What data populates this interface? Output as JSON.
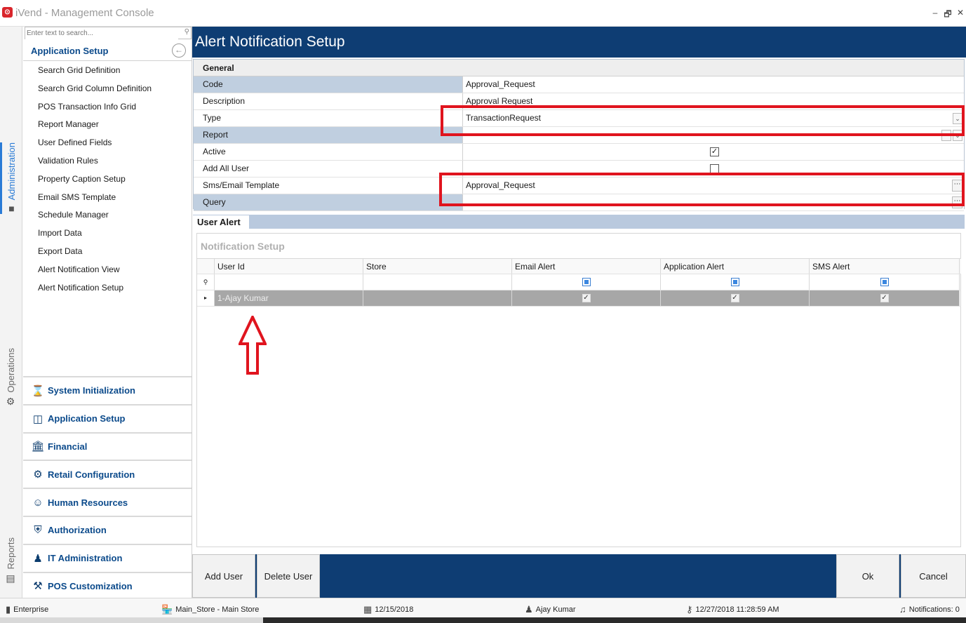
{
  "window": {
    "title": "iVend - Management Console",
    "icon_letter": "⊙",
    "minimize": "–",
    "restore": "🗗",
    "close": "✕"
  },
  "vertical_tabs": [
    {
      "label": "Administration",
      "icon": "administration-icon",
      "active": true
    },
    {
      "label": "Operations",
      "icon": "gear-icon",
      "active": false
    },
    {
      "label": "Reports",
      "icon": "reports-icon",
      "active": false
    }
  ],
  "search": {
    "placeholder": "Enter text to search..."
  },
  "nav": {
    "heading": "Application Setup",
    "items": [
      "Search Grid Definition",
      "Search Grid Column Definition",
      "POS Transaction Info Grid",
      "Report Manager",
      "User Defined Fields",
      "Validation Rules",
      "Property Caption Setup",
      "Email SMS Template",
      "Schedule Manager",
      "Import Data",
      "Export Data",
      "Alert Notification View",
      "Alert Notification Setup"
    ],
    "modules": [
      {
        "label": "System Initialization",
        "icon": "hourglass-icon"
      },
      {
        "label": "Application Setup",
        "icon": "window-icon"
      },
      {
        "label": "Financial",
        "icon": "bank-icon"
      },
      {
        "label": "Retail Configuration",
        "icon": "gears-icon"
      },
      {
        "label": "Human Resources",
        "icon": "users-icon"
      },
      {
        "label": "Authorization",
        "icon": "shield-icon"
      },
      {
        "label": "IT Administration",
        "icon": "user-icon"
      },
      {
        "label": "POS Customization",
        "icon": "pos-icon"
      }
    ]
  },
  "page": {
    "title": "Alert Notification Setup"
  },
  "form": {
    "section": "General",
    "rows": [
      {
        "label": "Code",
        "value": "Approval_Request"
      },
      {
        "label": "Description",
        "value": "Approval Request"
      },
      {
        "label": "Type",
        "value": "TransactionRequest"
      },
      {
        "label": "Report",
        "value": ""
      },
      {
        "label": "Active",
        "value": ""
      },
      {
        "label": "Add All User",
        "value": ""
      },
      {
        "label": "Sms/Email Template",
        "value": "Approval_Request"
      },
      {
        "label": "Query",
        "value": ""
      }
    ],
    "active_checked": true,
    "add_all_user_checked": false
  },
  "tabs": {
    "user_alert": "User Alert"
  },
  "notification": {
    "title": "Notification Setup",
    "columns": [
      "User Id",
      "Store",
      "Email Alert",
      "Application Alert",
      "SMS Alert"
    ],
    "filter_icon": "⚲",
    "rows": [
      {
        "user_id": "1-Ajay Kumar",
        "store": "",
        "email": true,
        "app": true,
        "sms": true
      }
    ]
  },
  "footer": {
    "add_user": "Add User",
    "delete_user": "Delete User",
    "ok": "Ok",
    "cancel": "Cancel"
  },
  "status": {
    "company": "Enterprise",
    "store": "Main_Store - Main Store",
    "date": "12/15/2018",
    "user": "Ajay Kumar",
    "login_time": "12/27/2018 11:28:59 AM",
    "notifications": "Notifications: 0"
  },
  "colors": {
    "header": "#0e3d73",
    "accent": "#0b4a8b",
    "annotation_red": "#e0141e"
  }
}
